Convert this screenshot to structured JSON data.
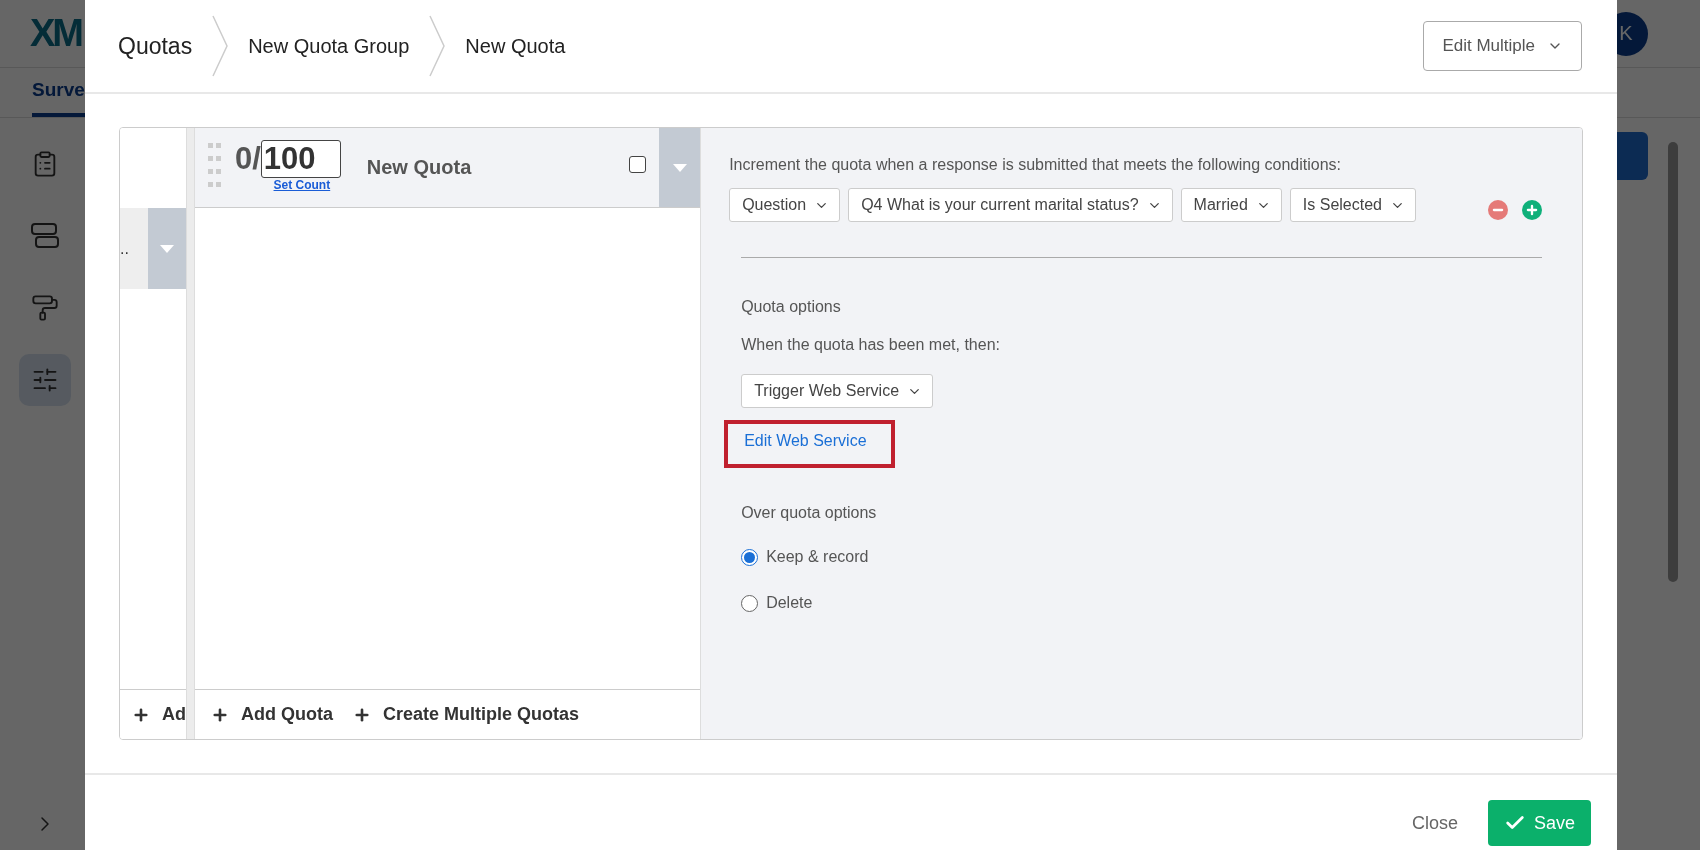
{
  "app": {
    "logo": "XM",
    "tab": "Surve",
    "avatar": "K",
    "sidebar": [
      {
        "kind": "clipboard",
        "selected": false
      },
      {
        "kind": "layers",
        "selected": false
      },
      {
        "kind": "roller",
        "selected": false
      },
      {
        "kind": "sliders",
        "selected": true
      }
    ]
  },
  "modal": {
    "breadcrumb": [
      "Quotas",
      "New Quota Group",
      "New Quota"
    ],
    "edit_button": "Edit Multiple",
    "groups_column": {
      "row_label": "..",
      "add_label": "Ad"
    },
    "quota": {
      "count": "0/",
      "limit": "100",
      "set_count": "Set Count",
      "name": "New Quota",
      "checked": false
    },
    "quota_actions": [
      "Add Quota",
      "Create Multiple Quotas"
    ],
    "conditions": {
      "intro": "Increment the quota when a response is submitted that meets the following conditions:",
      "dropdowns": [
        "Question",
        "Q4 What is your current marital status?",
        "Married",
        "Is Selected"
      ]
    },
    "quota_options": {
      "title": "Quota options",
      "prompt": "When the quota has been met, then:",
      "action": "Trigger Web Service",
      "link": "Edit Web Service",
      "highlighted": true
    },
    "over_quota": {
      "title": "Over quota options",
      "options": [
        {
          "label": "Keep & record",
          "selected": true
        },
        {
          "label": "Delete",
          "selected": false
        }
      ]
    },
    "footer": {
      "close": "Close",
      "save": "Save"
    }
  }
}
